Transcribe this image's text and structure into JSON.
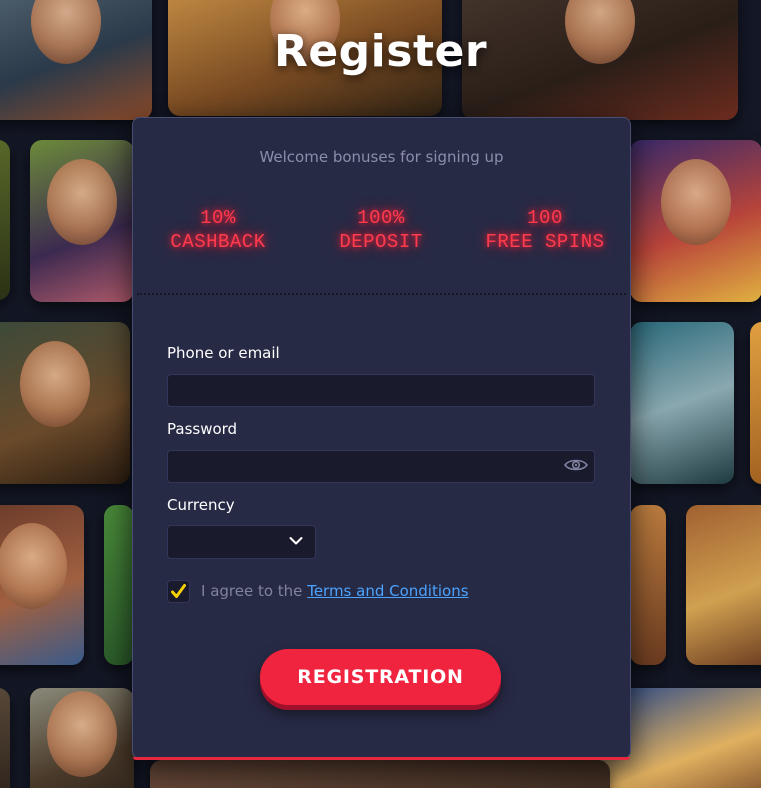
{
  "page": {
    "title": "Register"
  },
  "bonus": {
    "intro": "Welcome bonuses for signing up",
    "items": [
      {
        "line1": "10%",
        "line2": "CASHBACK"
      },
      {
        "line1": "100%",
        "line2": "DEPOSIT"
      },
      {
        "line1": "100",
        "line2": "FREE SPINS"
      }
    ]
  },
  "form": {
    "phone_label": "Phone or email",
    "phone_value": "",
    "password_label": "Password",
    "password_value": "",
    "currency_label": "Currency",
    "currency_value": "",
    "agree_checked": true,
    "agree_prefix": "I agree to the",
    "terms_link": "Terms and Conditions",
    "submit_label": "REGISTRATION"
  },
  "icons": {
    "password_toggle": "eye-icon",
    "currency_dropdown": "chevron-down-icon",
    "checkbox_mark": "check-icon"
  },
  "colors": {
    "panel_bg": "#272a45",
    "bonus_neon": "#ff3b4e",
    "button": "#f0243f",
    "checkbox_accent": "#f5d000",
    "link": "#4aa3ff"
  }
}
